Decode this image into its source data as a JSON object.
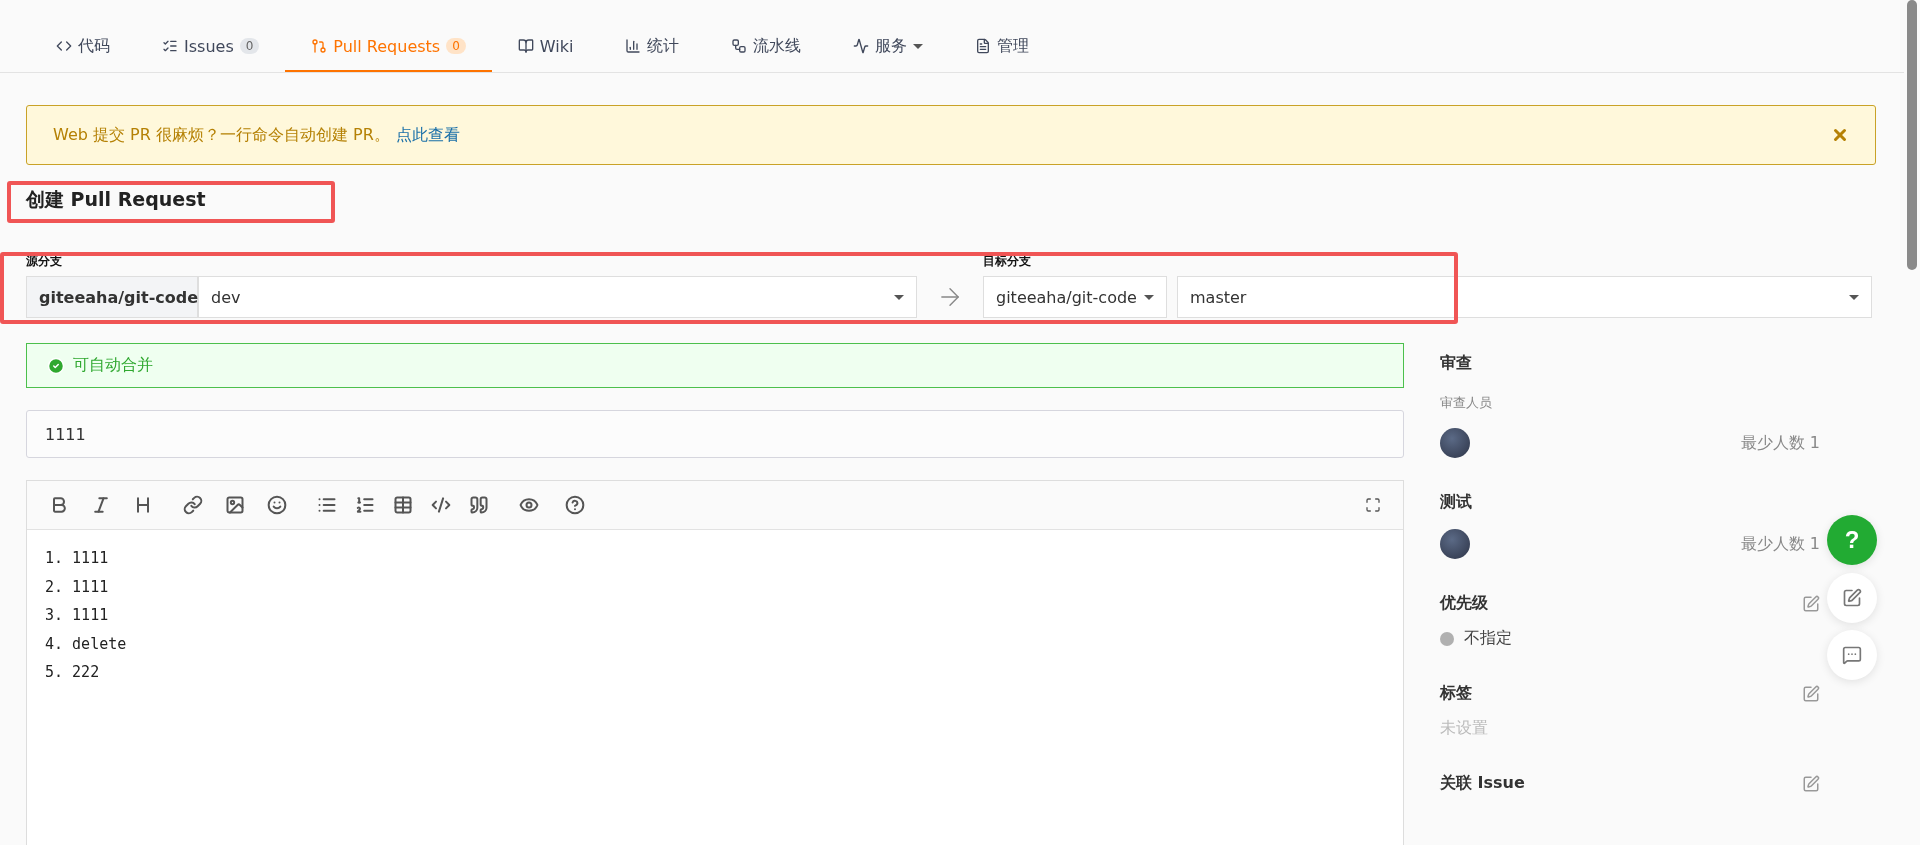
{
  "tabs": [
    {
      "label": "代码",
      "selected": false
    },
    {
      "label": "Issues",
      "count": "0",
      "selected": false
    },
    {
      "label": "Pull Requests",
      "count": "0",
      "selected": true
    },
    {
      "label": "Wiki",
      "selected": false
    },
    {
      "label": "统计",
      "selected": false
    },
    {
      "label": "流水线",
      "selected": false
    },
    {
      "label": "服务",
      "dropdown": true,
      "selected": false
    },
    {
      "label": "管理",
      "selected": false
    }
  ],
  "notice": {
    "text": "Web 提交 PR 很麻烦？一行命令自动创建 PR。",
    "link": "点此查看"
  },
  "page_title": "创建 Pull Request",
  "source": {
    "label": "源分支",
    "repo": "giteeaha/git-code",
    "branch": "dev"
  },
  "target": {
    "label": "目标分支",
    "repo": "giteeaha/git-code",
    "branch": "master"
  },
  "merge_status": {
    "text": "可自动合并",
    "ok": true
  },
  "title_field": {
    "value": "1111"
  },
  "editor": {
    "lines": [
      "1. 1111",
      "2. 1111",
      "3. 1111",
      "4. delete",
      "5. 222"
    ]
  },
  "help_button": {
    "label": "?"
  },
  "sidebar": [
    {
      "kind": "people",
      "title": "审查",
      "subtitle": "审查人员",
      "note": "最少人数 1"
    },
    {
      "kind": "people",
      "title": "测试",
      "note": "最少人数 1"
    },
    {
      "kind": "priority",
      "title": "优先级",
      "value": "不指定",
      "color": "#b0b0b0",
      "editable": true
    },
    {
      "kind": "empty",
      "title": "标签",
      "value": "未设置",
      "editable": true
    },
    {
      "kind": "empty",
      "title": "关联 Issue",
      "editable": true
    }
  ]
}
